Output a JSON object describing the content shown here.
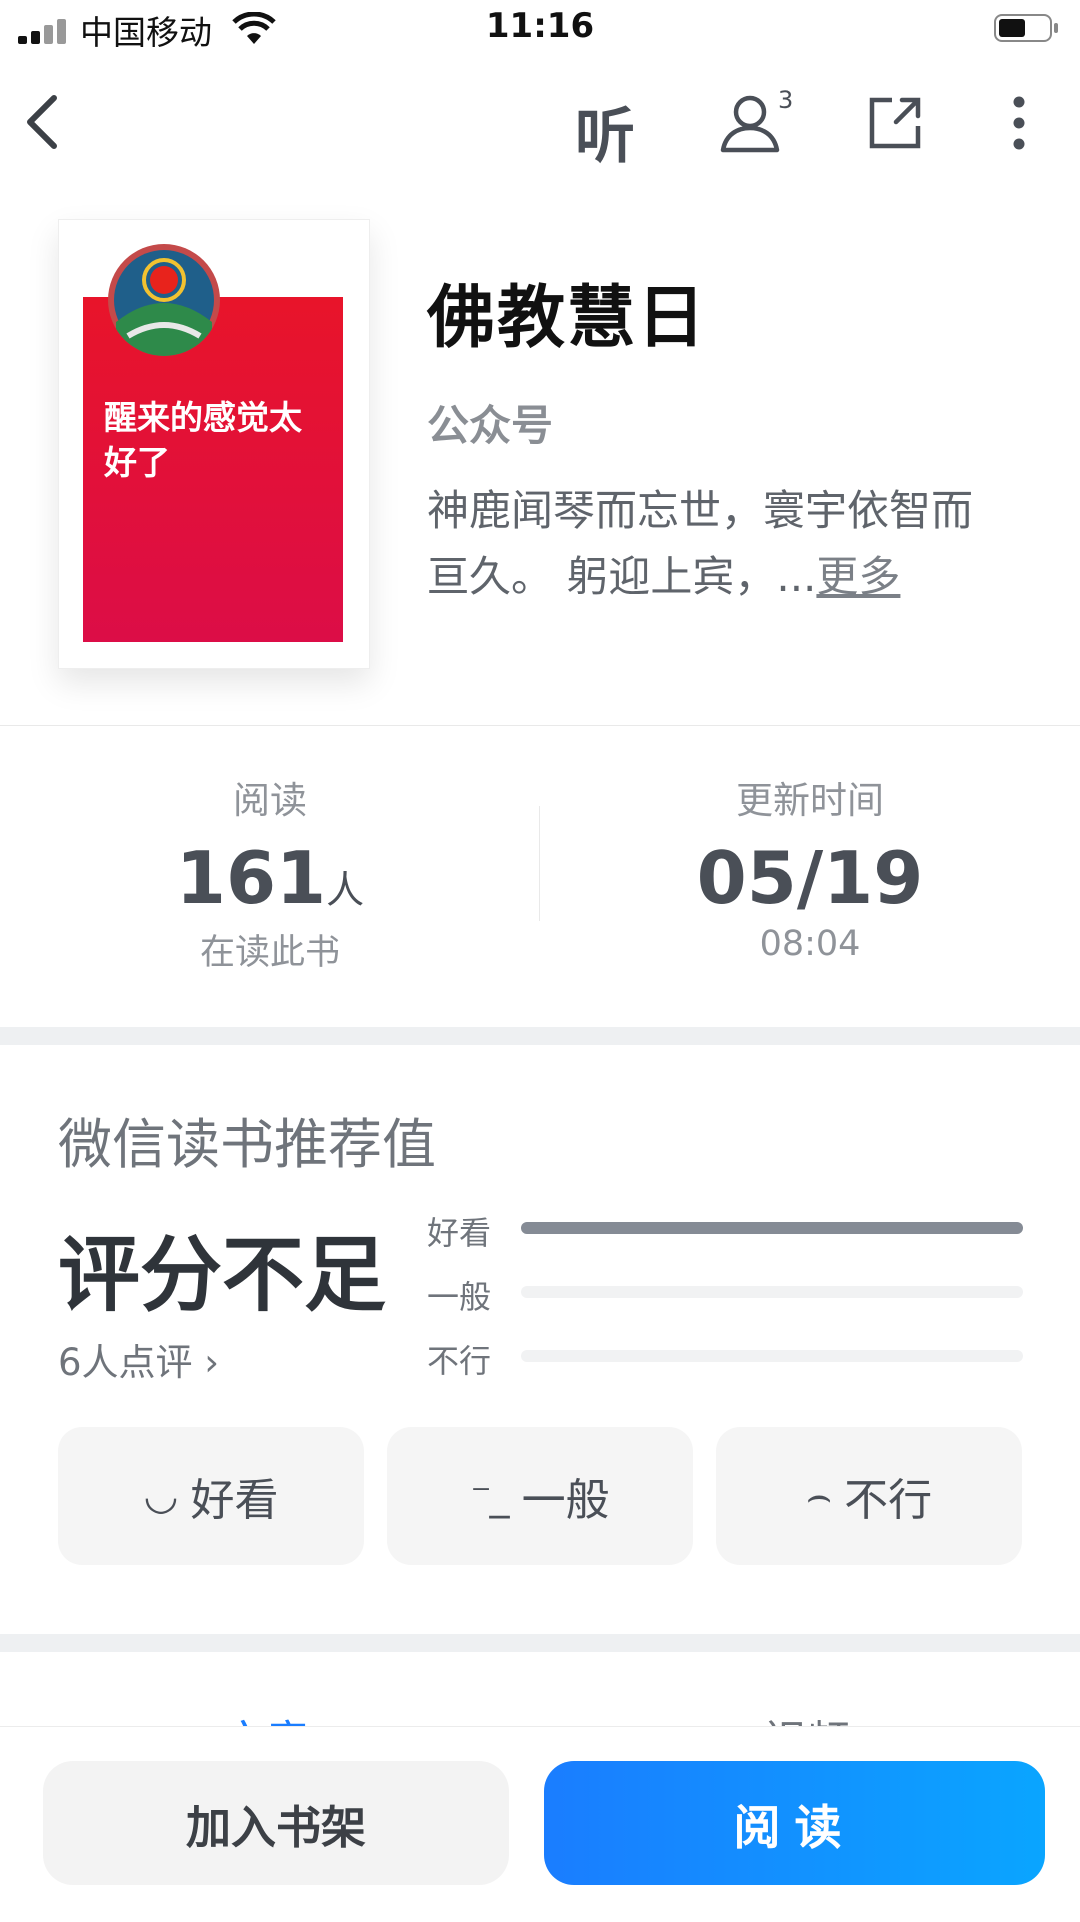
{
  "status_bar": {
    "carrier": "中国移动",
    "time": "11:16"
  },
  "nav": {
    "listen_label": "听",
    "readers_count": "3"
  },
  "book": {
    "cover_text": "醒来的感觉太好了",
    "title": "佛教慧日",
    "type": "公众号",
    "description": "神鹿闻琴而忘世，寰宇依智而亘久。 躬迎上宾，...",
    "more_label": "更多"
  },
  "stats": {
    "reading": {
      "label": "阅读",
      "value": "161",
      "unit": "人",
      "sub": "在读此书"
    },
    "updated": {
      "label": "更新时间",
      "date": "05/19",
      "time": "08:04"
    }
  },
  "rating": {
    "section_title": "微信读书推荐值",
    "score_text": "评分不足",
    "review_count": "6人点评",
    "bars": [
      {
        "label": "好看",
        "fraction": 1.0
      },
      {
        "label": "一般",
        "fraction": 0.0
      },
      {
        "label": "不行",
        "fraction": 0.0
      }
    ],
    "buttons": [
      {
        "face": "◡",
        "label": "好看"
      },
      {
        "face": "⁻_",
        "label": "一般"
      },
      {
        "face": "⌢",
        "label": "不行"
      }
    ]
  },
  "tabs": [
    "文章",
    "视频"
  ],
  "actions": {
    "add_to_shelf": "加入书架",
    "read": "阅读"
  },
  "colors": {
    "accent": "#1a7dff",
    "cover_red": "#e8142a",
    "bar_fill": "#858b95"
  }
}
